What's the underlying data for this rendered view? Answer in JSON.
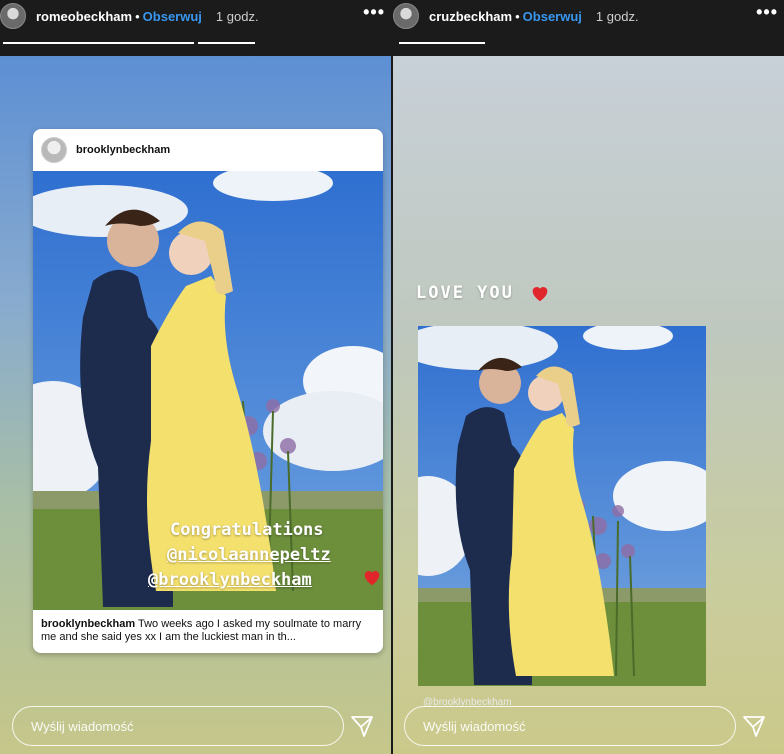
{
  "left_story": {
    "username": "romeobeckham",
    "follow_label": "Obserwuj",
    "time": "1 godz.",
    "more_icon": "more-horizontal-icon",
    "repost": {
      "username": "brooklynbeckham",
      "caption_user": "brooklynbeckham",
      "caption_text": "Two weeks ago I asked my soulmate to marry me and she said yes xx I am the luckiest  man in th..."
    },
    "overlay": {
      "line1": "Congratulations",
      "line2": "@nicolaannepeltz",
      "line3": "@brooklynbeckham"
    },
    "message_placeholder": "Wyślij wiadomość",
    "send_icon": "send-icon"
  },
  "right_story": {
    "username": "cruzbeckham",
    "follow_label": "Obserwuj",
    "time": "1 godz.",
    "more_icon": "more-horizontal-icon",
    "caption": "LOVE YOU",
    "photo_credit": "@brooklynbeckham",
    "message_placeholder": "Wyślij wiadomość",
    "send_icon": "send-icon"
  },
  "colors": {
    "follow": "#3897f0",
    "heart": "#e0252b",
    "topbar": "#1b1b1b"
  }
}
